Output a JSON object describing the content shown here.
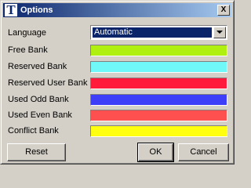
{
  "window": {
    "title": "Options",
    "icon_letter": "T",
    "close_glyph": "X"
  },
  "language": {
    "label": "Language",
    "selected": "Automatic"
  },
  "banks": [
    {
      "label": "Free Bank",
      "color": "#b0f010"
    },
    {
      "label": "Reserved Bank",
      "color": "#70f8f8"
    },
    {
      "label": "Reserved User Bank",
      "color": "#ff1a3c"
    },
    {
      "label": "Used Odd Bank",
      "color": "#3e3ef8"
    },
    {
      "label": "Used Even Bank",
      "color": "#ff5050"
    },
    {
      "label": "Conflict Bank",
      "color": "#ffff10"
    }
  ],
  "buttons": {
    "reset": "Reset",
    "ok": "OK",
    "cancel": "Cancel"
  }
}
